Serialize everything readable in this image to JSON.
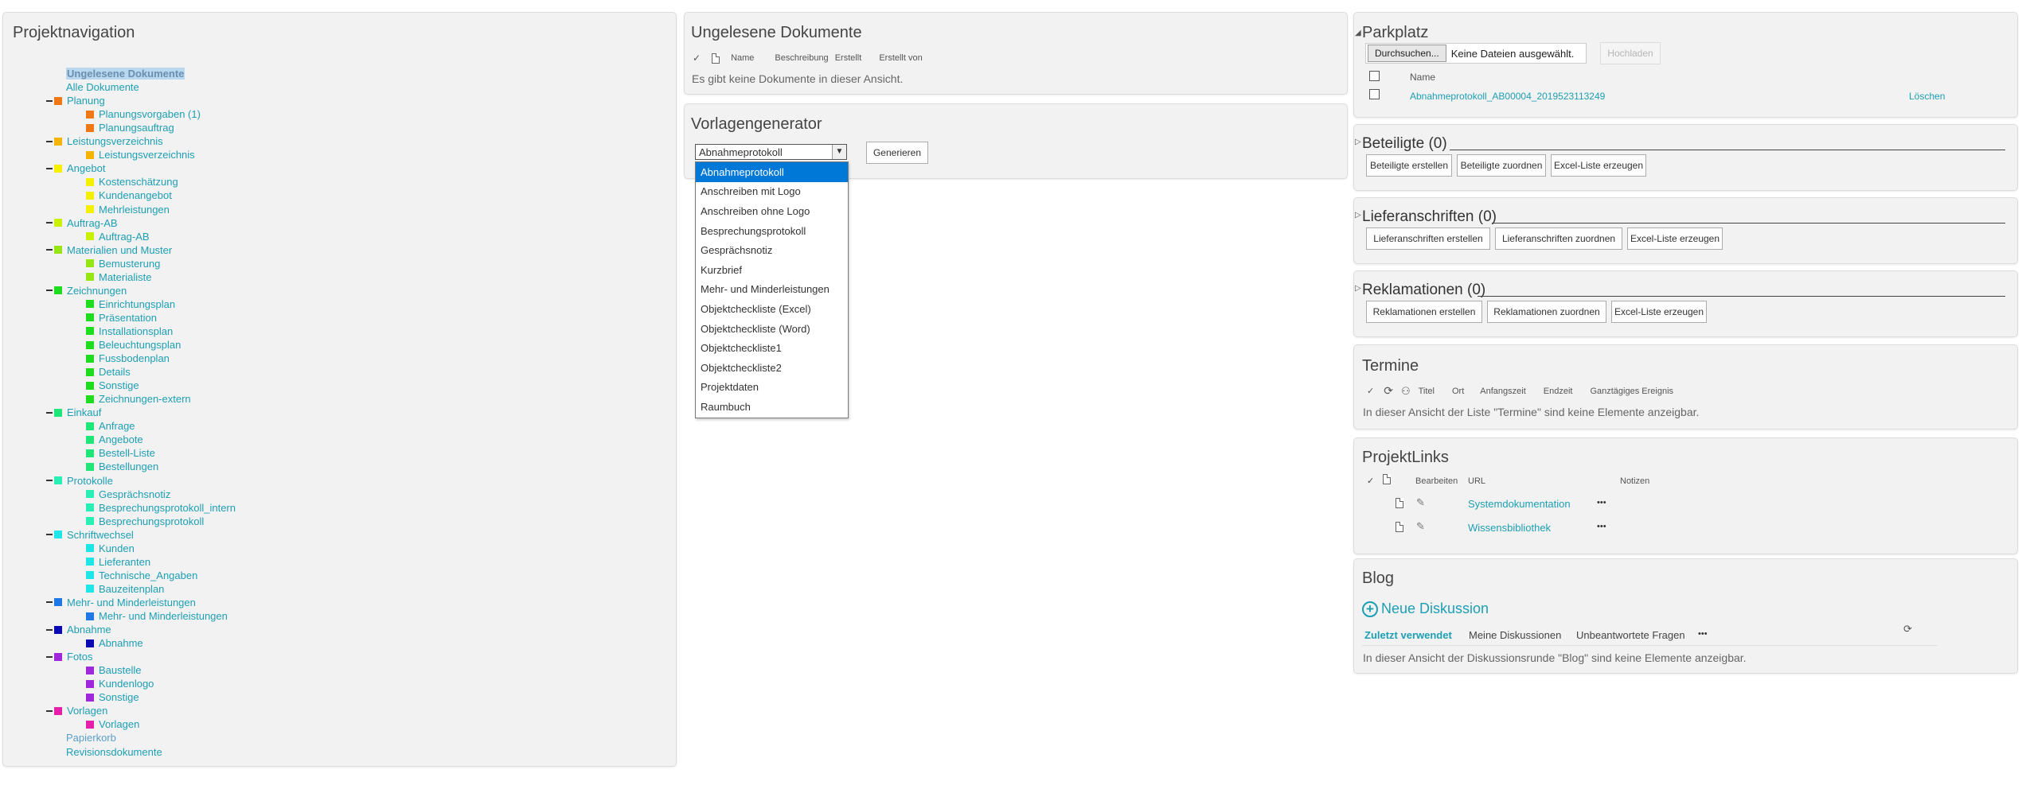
{
  "nav": {
    "title": "Projektnavigation",
    "items": [
      {
        "label": "Ungelesene Dokumente",
        "level": 0,
        "selected": true
      },
      {
        "label": "Alle Dokumente",
        "level": 0
      },
      {
        "label": "Planung",
        "level": 1,
        "color": "#f07814"
      },
      {
        "label": "Planungsvorgaben (1)",
        "level": 2,
        "color": "#f07814"
      },
      {
        "label": "Planungsauftrag",
        "level": 2,
        "color": "#f07814"
      },
      {
        "label": "Leistungsverzeichnis",
        "level": 1,
        "color": "#f5b400"
      },
      {
        "label": "Leistungsverzeichnis",
        "level": 2,
        "color": "#f5b400"
      },
      {
        "label": "Angebot",
        "level": 1,
        "color": "#f5f000"
      },
      {
        "label": "Kostenschätzung",
        "level": 2,
        "color": "#f5f000"
      },
      {
        "label": "Kundenangebot",
        "level": 2,
        "color": "#f5f000"
      },
      {
        "label": "Mehrleistungen",
        "level": 2,
        "color": "#f5f000"
      },
      {
        "label": "Auftrag-AB",
        "level": 1,
        "color": "#c8f000"
      },
      {
        "label": "Auftrag-AB",
        "level": 2,
        "color": "#c8f000"
      },
      {
        "label": "Materialien und Muster",
        "level": 1,
        "color": "#96e614"
      },
      {
        "label": "Bemusterung",
        "level": 2,
        "color": "#96e614"
      },
      {
        "label": "Materialiste",
        "level": 2,
        "color": "#96e614"
      },
      {
        "label": "Zeichnungen",
        "level": 1,
        "color": "#1edc1e"
      },
      {
        "label": "Einrichtungsplan",
        "level": 2,
        "color": "#1edc1e"
      },
      {
        "label": "Präsentation",
        "level": 2,
        "color": "#1edc1e"
      },
      {
        "label": "Installationsplan",
        "level": 2,
        "color": "#1edc1e"
      },
      {
        "label": "Beleuchtungsplan",
        "level": 2,
        "color": "#1edc1e"
      },
      {
        "label": "Fussbodenplan",
        "level": 2,
        "color": "#1edc1e"
      },
      {
        "label": "Details",
        "level": 2,
        "color": "#1edc1e"
      },
      {
        "label": "Sonstige",
        "level": 2,
        "color": "#1edc1e"
      },
      {
        "label": "Zeichnungen-extern",
        "level": 2,
        "color": "#1edc1e"
      },
      {
        "label": "Einkauf",
        "level": 1,
        "color": "#1ee678"
      },
      {
        "label": "Anfrage",
        "level": 2,
        "color": "#1ee678"
      },
      {
        "label": "Angebote",
        "level": 2,
        "color": "#1ee678"
      },
      {
        "label": "Bestell-Liste",
        "level": 2,
        "color": "#1ee678"
      },
      {
        "label": "Bestellungen",
        "level": 2,
        "color": "#1ee678"
      },
      {
        "label": "Protokolle",
        "level": 1,
        "color": "#28f0b4"
      },
      {
        "label": "Gesprächsnotiz",
        "level": 2,
        "color": "#28f0b4"
      },
      {
        "label": "Besprechungsprotokoll_intern",
        "level": 2,
        "color": "#28f0b4"
      },
      {
        "label": "Besprechungsprotokoll",
        "level": 2,
        "color": "#28f0b4"
      },
      {
        "label": "Schriftwechsel",
        "level": 1,
        "color": "#1ee6e6"
      },
      {
        "label": "Kunden",
        "level": 2,
        "color": "#1ee6e6"
      },
      {
        "label": "Lieferanten",
        "level": 2,
        "color": "#1ee6e6"
      },
      {
        "label": "Technische_Angaben",
        "level": 2,
        "color": "#1ee6e6"
      },
      {
        "label": "Bauzeitenplan",
        "level": 2,
        "color": "#1ee6e6"
      },
      {
        "label": "Mehr- und Minderleistungen",
        "level": 1,
        "color": "#1e78e6"
      },
      {
        "label": "Mehr- und Minderleistungen",
        "level": 2,
        "color": "#1e78e6"
      },
      {
        "label": "Abnahme",
        "level": 1,
        "color": "#0a0ab4"
      },
      {
        "label": "Abnahme",
        "level": 2,
        "color": "#0a0ab4"
      },
      {
        "label": "Fotos",
        "level": 1,
        "color": "#a028dc"
      },
      {
        "label": "Baustelle",
        "level": 2,
        "color": "#a028dc"
      },
      {
        "label": "Kundenlogo",
        "level": 2,
        "color": "#a028dc"
      },
      {
        "label": "Sonstige",
        "level": 2,
        "color": "#a028dc"
      },
      {
        "label": "Vorlagen",
        "level": 1,
        "color": "#e61eaa"
      },
      {
        "label": "Vorlagen",
        "level": 2,
        "color": "#e61eaa"
      },
      {
        "label": "Papierkorb",
        "level": 0,
        "muted": true
      },
      {
        "label": "Revisionsdokumente",
        "level": 0
      }
    ]
  },
  "unread": {
    "title": "Ungelesene Dokumente",
    "columns": [
      "Name",
      "Beschreibung",
      "Erstellt",
      "Erstellt von"
    ],
    "empty": "Es gibt keine Dokumente in dieser Ansicht."
  },
  "generator": {
    "title": "Vorlagengenerator",
    "selected": "Abnahmeprotokoll",
    "button": "Generieren",
    "options": [
      "Abnahmeprotokoll",
      "Anschreiben mit Logo",
      "Anschreiben ohne Logo",
      "Besprechungsprotokoll",
      "Gesprächsnotiz",
      "Kurzbrief",
      "Mehr- und Minderleistungen",
      "Objektcheckliste (Excel)",
      "Objektcheckliste (Word)",
      "Objektcheckliste1",
      "Objektcheckliste2",
      "Projektdaten",
      "Raumbuch"
    ]
  },
  "parkplatz": {
    "title": "Parkplatz",
    "browse": "Durchsuchen...",
    "no_file": "Keine Dateien ausgewählt.",
    "upload": "Hochladen",
    "col_name": "Name",
    "file": "Abnahmeprotokoll_AB00004_2019523113249",
    "delete": "Löschen"
  },
  "beteiligte": {
    "title": "Beteiligte (0)",
    "buttons": [
      "Beteiligte erstellen",
      "Beteiligte zuordnen",
      "Excel-Liste erzeugen"
    ]
  },
  "lieferanschriften": {
    "title": "Lieferanschriften (0)",
    "buttons": [
      "Lieferanschriften erstellen",
      "Lieferanschriften zuordnen",
      "Excel-Liste erzeugen"
    ]
  },
  "reklamationen": {
    "title": "Reklamationen (0)",
    "buttons": [
      "Reklamationen erstellen",
      "Reklamationen zuordnen",
      "Excel-Liste erzeugen"
    ]
  },
  "termine": {
    "title": "Termine",
    "columns": [
      "Titel",
      "Ort",
      "Anfangszeit",
      "Endzeit",
      "Ganztägiges Ereignis"
    ],
    "empty": "In dieser Ansicht der Liste \"Termine\" sind keine Elemente anzeigbar."
  },
  "links": {
    "title": "ProjektLinks",
    "columns": [
      "Bearbeiten",
      "URL",
      "Notizen"
    ],
    "rows": [
      "Systemdokumentation",
      "Wissensbibliothek"
    ],
    "more": "•••"
  },
  "blog": {
    "title": "Blog",
    "new": "Neue Diskussion",
    "tabs": [
      "Zuletzt verwendet",
      "Meine Diskussionen",
      "Unbeantwortete Fragen"
    ],
    "more": "•••",
    "empty": "In dieser Ansicht der Diskussionsrunde \"Blog\" sind keine Elemente anzeigbar."
  }
}
